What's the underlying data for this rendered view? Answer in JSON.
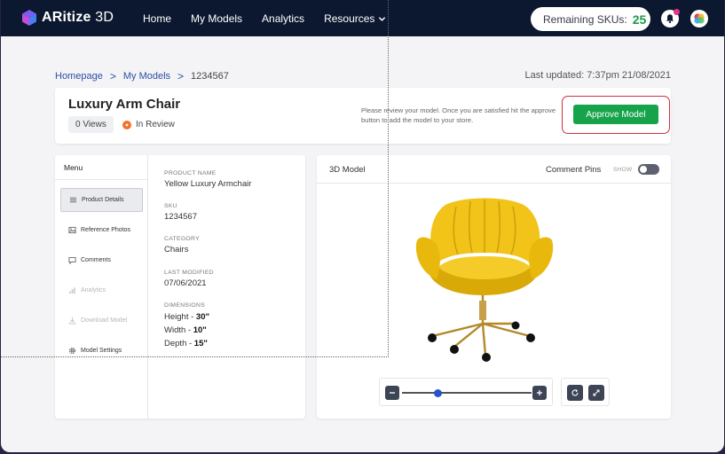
{
  "brand": {
    "name_bold": "ARitize",
    "name_thin": " 3D"
  },
  "nav": {
    "home": "Home",
    "my_models": "My Models",
    "analytics": "Analytics",
    "resources": "Resources"
  },
  "skus": {
    "label": "Remaining SKUs:",
    "count": "25"
  },
  "breadcrumb": {
    "home": "Homepage",
    "models": "My Models",
    "current": "1234567",
    "sep": ">"
  },
  "last_updated": "Last updated: 7:37pm  21/08/2021",
  "product": {
    "title": "Luxury Arm Chair",
    "views": "0 Views",
    "status": "In Review",
    "hint": "Please review your model. Once you are satisfied hit the approve button to add the model to your store.",
    "approve_label": "Approve Model"
  },
  "menu": {
    "heading": "Menu",
    "items": [
      {
        "label": "Product Details",
        "icon": "list-icon",
        "state": "active"
      },
      {
        "label": "Reference Photos",
        "icon": "image-icon",
        "state": "normal"
      },
      {
        "label": "Comments",
        "icon": "comment-icon",
        "state": "normal"
      },
      {
        "label": "Analytics",
        "icon": "bar-chart-icon",
        "state": "disabled"
      },
      {
        "label": "Download Model",
        "icon": "download-icon",
        "state": "disabled"
      },
      {
        "label": "Model Settings",
        "icon": "gear-icon",
        "state": "normal"
      }
    ]
  },
  "details": {
    "name_label": "PRODUCT NAME",
    "name": "Yellow Luxury Armchair",
    "sku_label": "SKU",
    "sku": "1234567",
    "category_label": "CATEGORY",
    "category": "Chairs",
    "modified_label": "LAST MODIFIED",
    "modified": "07/06/2021",
    "dimensions_label": "DIMENSIONS",
    "height_label": "Height - ",
    "height": "30\"",
    "width_label": "Width - ",
    "width": "10\"",
    "depth_label": "Depth - ",
    "depth": "15\""
  },
  "viewer": {
    "title": "3D Model",
    "pins_label": "Comment Pins",
    "show_label": "SHOW",
    "pins_on": false,
    "zoom_level": 0.28
  },
  "colors": {
    "approve": "#17a34a",
    "skus_count": "#1a9a4d",
    "status_dot": "#f4712a",
    "chair": "#f2c318",
    "nav_bg": "#0c1830"
  }
}
